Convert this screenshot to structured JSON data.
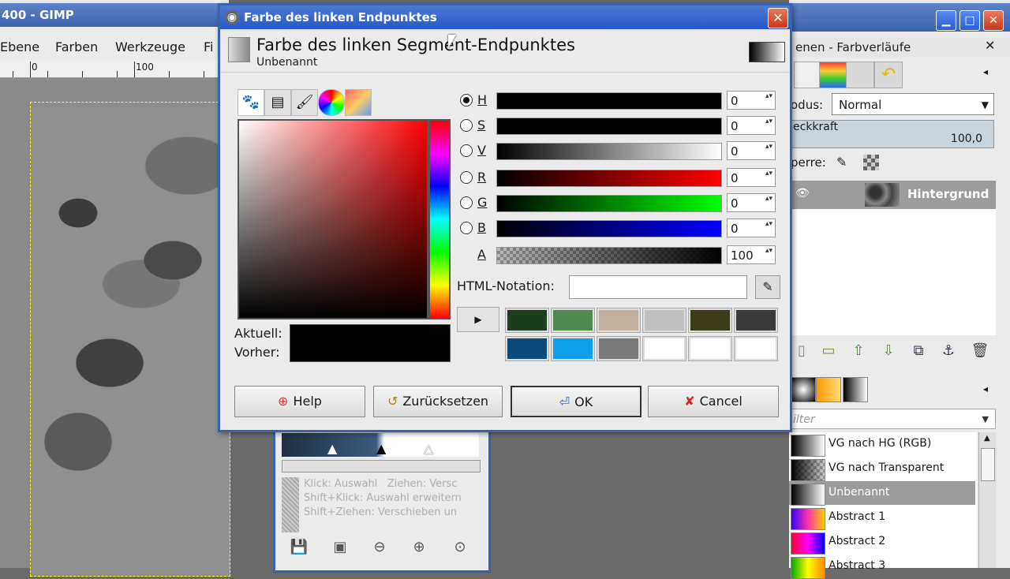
{
  "gimp": {
    "title": "400 - GIMP",
    "menu": [
      "Ebene",
      "Farben",
      "Werkzeuge",
      "Fi"
    ],
    "ruler": [
      "0",
      "100"
    ]
  },
  "dock": {
    "subtitle": "enen - Farbverläufe",
    "mode_label": "odus:",
    "mode_value": "Normal",
    "opacity_label": "eckkraft",
    "opacity_value": "100,0",
    "lock_label": "perre:",
    "layer_name": "Hintergrund",
    "filter_placeholder": "ilter",
    "gradients": [
      {
        "name": "VG nach HG (RGB)"
      },
      {
        "name": "VG nach Transparent"
      },
      {
        "name": "Unbenannt"
      },
      {
        "name": "Abstract 1"
      },
      {
        "name": "Abstract 2"
      },
      {
        "name": "Abstract 3"
      }
    ]
  },
  "gradient_editor": {
    "hint": "Klick: Auswahl   Ziehen: Versc\nShift+Klick: Auswahl erweitern\nShift+Ziehen: Verschieben un"
  },
  "dialog": {
    "title": "Farbe des linken Endpunktes",
    "heading": "Farbe des linken Segment-Endpunktes",
    "subheading": "Unbenannt",
    "channels": [
      {
        "letter": "H",
        "value": "0",
        "selected": true
      },
      {
        "letter": "S",
        "value": "0",
        "selected": false
      },
      {
        "letter": "V",
        "value": "0",
        "selected": false
      },
      {
        "letter": "R",
        "value": "0",
        "selected": false
      },
      {
        "letter": "G",
        "value": "0",
        "selected": false
      },
      {
        "letter": "B",
        "value": "0",
        "selected": false
      },
      {
        "letter": "A",
        "value": "100",
        "selected": false
      }
    ],
    "current_label": "Aktuell:",
    "previous_label": "Vorher:",
    "html_label": "HTML-Notation:",
    "html_value": "",
    "history_colors": [
      "#1e3d1e",
      "#4f8a4f",
      "#c2b0a0",
      "#c0c0c0",
      "#3c3c1a",
      "#3a3a3a",
      "#0b4a7a",
      "#12a0ec",
      "#7a7a7a",
      "#ffffff",
      "#ffffff",
      "#ffffff"
    ],
    "buttons": {
      "help": "Help",
      "reset": "Zurücksetzen",
      "ok": "OK",
      "cancel": "Cancel"
    }
  }
}
